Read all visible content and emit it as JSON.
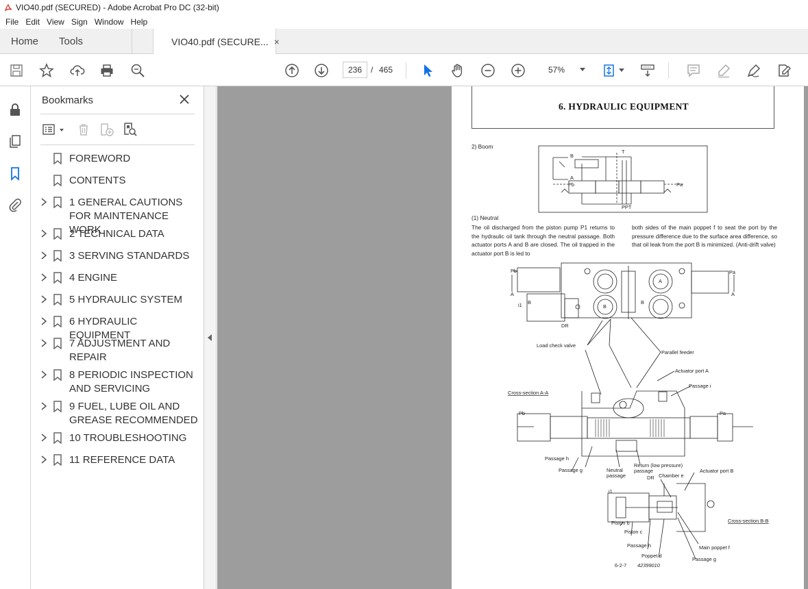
{
  "window": {
    "title": "VIO40.pdf (SECURED) - Adobe Acrobat Pro DC (32-bit)"
  },
  "menu": [
    "File",
    "Edit",
    "View",
    "Sign",
    "Window",
    "Help"
  ],
  "tabs": {
    "home": "Home",
    "tools": "Tools",
    "document": "VIO40.pdf (SECURE...",
    "close": "×"
  },
  "toolbar": {
    "current_page": "236",
    "page_separator": "/",
    "total_pages": "465",
    "zoom": "57%"
  },
  "bookmarks": {
    "header": "Bookmarks",
    "items": [
      {
        "label": "FOREWORD",
        "expandable": false
      },
      {
        "label": "CONTENTS",
        "expandable": false
      },
      {
        "label": " 1 GENERAL CAUTIONS FOR MAINTENANCE WORK",
        "expandable": true
      },
      {
        "label": "2 TECHNICAL DATA",
        "expandable": true
      },
      {
        "label": "3 SERVING STANDARDS",
        "expandable": true
      },
      {
        "label": "4 ENGINE",
        "expandable": true
      },
      {
        "label": "5 HYDRAULIC SYSTEM",
        "expandable": true
      },
      {
        "label": "6 HYDRAULIC EQUIPMENT",
        "expandable": true
      },
      {
        "label": "7 ADJUSTMENT AND REPAIR",
        "expandable": true
      },
      {
        "label": "8 PERIODIC INSPECTION AND SERVICING",
        "expandable": true
      },
      {
        "label": "9 FUEL, LUBE OIL AND GREASE RECOMMENDED",
        "expandable": true
      },
      {
        "label": "10 TROUBLESHOOTING",
        "expandable": true
      },
      {
        "label": "11 REFERENCE DATA",
        "expandable": true
      }
    ]
  },
  "document": {
    "heading": "6. HYDRAULIC EQUIPMENT",
    "section": "2) Boom",
    "subsection": "(1) Neutral",
    "para_left": "The oil discharged from the piston pump P1 returns to the hydraulic oil tank through the neutral passage. Both actuator ports A and B are closed. The oil trapped in the actuator port B is led to",
    "para_right": "both sides of the main poppet f to seat the port by the pressure difference due to the surface area difference, so that oil leak from the port B is minimized. (Anti-drift valve)",
    "labels": {
      "sch_b": "B",
      "sch_t": "T",
      "sch_a": "A",
      "sch_pb": "Pb",
      "sch_pa": "Pa",
      "sch_ppt": "PPT",
      "pb_top": "Pb",
      "pa_top": "Pa",
      "a_left": "A",
      "a_right": "A",
      "b_left": "B",
      "b_right": "B",
      "i1_top": "i1",
      "dr_top": "DR",
      "port_a": "A",
      "port_b": "B",
      "load_check": "Load check valve",
      "parallel_feeder": "Parallel feeder",
      "actuator_a": "Actuator port A",
      "passage_i": "Passage i",
      "cross_aa": "Cross-section A-A",
      "pb_mid": "Pb",
      "pa_mid": "Pa",
      "passage_h1": "Passage h",
      "passage_g1": "Passage g",
      "neutral_passage_1": "Neutral",
      "neutral_passage_2": "passage",
      "return_1": "Return (low pressure)",
      "return_2": "passage",
      "chamber_e": "Chamber e",
      "actuator_b": "Actuator port B",
      "dr_bottom": "DR",
      "i1_bottom": "i1",
      "piston_b": "Piston b",
      "piston_c": "Piston c",
      "passage_h2": "Passage h",
      "poppet_d": "Poppet d",
      "main_poppet": "Main poppet f",
      "passage_g2": "Passage g",
      "cross_bb": "Cross-section B-B",
      "fig_no": "6-2-7",
      "fig_code": "42399010"
    }
  }
}
